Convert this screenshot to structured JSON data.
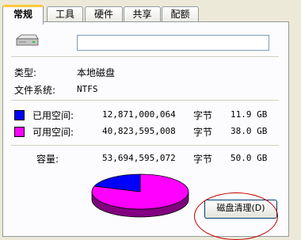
{
  "tabs": [
    {
      "label": "常规",
      "active": true
    },
    {
      "label": "工具",
      "active": false
    },
    {
      "label": "硬件",
      "active": false
    },
    {
      "label": "共享",
      "active": false
    },
    {
      "label": "配额",
      "active": false
    }
  ],
  "general": {
    "drive_icon": "hard-disk-icon",
    "volume_name": "",
    "type_label": "类型:",
    "type_value": "本地磁盘",
    "fs_label": "文件系统:",
    "fs_value": "NTFS"
  },
  "space": {
    "used_label": "已用空间:",
    "used_bytes": "12,871,000,064",
    "used_unit": "字节",
    "used_size": "11.9 GB",
    "used_color": "#0000ff",
    "free_label": "可用空间:",
    "free_bytes": "40,823,595,008",
    "free_unit": "字节",
    "free_size": "38.0 GB",
    "free_color": "#ff00ff",
    "capacity_label": "容量:",
    "capacity_bytes": "53,694,595,072",
    "capacity_unit": "字节",
    "capacity_size": "50.0 GB"
  },
  "cleanup_button": "磁盘清理(D)",
  "annotation_color": "#c00000"
}
